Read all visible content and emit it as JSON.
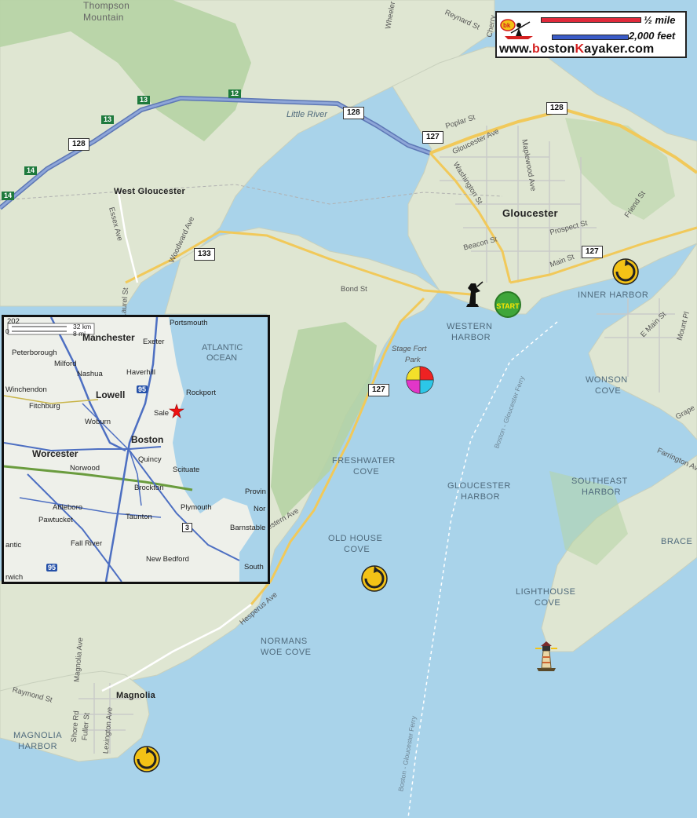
{
  "legend": {
    "scale_mile": "½ mile",
    "scale_feet": "2,000 feet",
    "site_prefix": "www.",
    "site_b": "b",
    "site_mid": "oston",
    "site_k": "K",
    "site_end": "ayaker.com",
    "logo_text": "bk",
    "bar_mile_color": "#e02a3b",
    "bar_feet_color": "#3a5bc7"
  },
  "labels": {
    "thompson": "Thompson",
    "mountain": "Mountain",
    "west_gloucester": "West Gloucester",
    "gloucester": "Gloucester",
    "little_river": "Little River",
    "magnolia": "Magnolia",
    "inner_harbor_1": "INNER HARBOR",
    "western_harbor_1": "WESTERN",
    "western_harbor_2": "HARBOR",
    "wonson_1": "WONSON",
    "wonson_2": "COVE",
    "freshwater_1": "FRESHWATER",
    "freshwater_2": "COVE",
    "gloucester_harbor_1": "GLOUCESTER",
    "gloucester_harbor_2": "HARBOR",
    "southeast_1": "SOUTHEAST",
    "southeast_2": "HARBOR",
    "brace": "BRACE",
    "old_house_1": "OLD HOUSE",
    "old_house_2": "COVE",
    "lighthouse_1": "LIGHTHOUSE",
    "lighthouse_2": "COVE",
    "normans_1": "NORMANS",
    "normans_2": "WOE COVE",
    "magnolia_harbor_1": "MAGNOLIA",
    "magnolia_harbor_2": "HARBOR",
    "stage_fort_1": "Stage Fort",
    "stage_fort_2": "Park",
    "start": "START"
  },
  "streets": {
    "reynard": "Reynard St",
    "wheeler": "Wheeler",
    "poplar": "Poplar St",
    "gloucester_ave": "Gloucester Ave",
    "maplewood": "Maplewood Ave",
    "washington": "Washington St",
    "beacon": "Beacon St",
    "prospect": "Prospect St",
    "main": "Main St",
    "friend": "Friend St",
    "essex": "Essex Ave",
    "woodward": "Woodward Ave",
    "laurel": "Laurel St",
    "bond": "Bond St",
    "western_ave": "Western Ave",
    "hesperus": "Hesperus Ave",
    "magnolia_ave": "Magnolia Ave",
    "raymond": "Raymond St",
    "shore": "Shore Rd",
    "fuller": "Fuller St",
    "lexington": "Lexington Ave",
    "e_main": "E Main St",
    "farrington": "Farrington Av",
    "mount": "Mount Pl",
    "grape": "Grape",
    "ferry1": "Boston - Gloucester Ferry",
    "ferry2": "Boston - Gloucester Ferry",
    "cherry": "Cherry"
  },
  "signs": {
    "r128_a": "128",
    "r128_b": "128",
    "r128_c": "128",
    "r127_a": "127",
    "r127_b": "127",
    "r127_c": "127",
    "r133": "133",
    "exit12": "12",
    "exit13_a": "13",
    "exit13_b": "13",
    "exit14_a": "14",
    "exit14_b": "14"
  },
  "inset": {
    "portsmouth": "Portsmouth",
    "manchester": "Manchester",
    "exeter": "Exeter",
    "atlantic": "ATLANTIC",
    "ocean": "OCEAN",
    "peterborough": "Peterborough",
    "milford": "Milford",
    "nashua": "Nashua",
    "haverhill": "Haverhill",
    "rockport": "Rockport",
    "fitchburg": "Fitchburg",
    "lowell": "Lowell",
    "salem": "Sale",
    "winchendon": "Winchendon",
    "woburn": "Woburn",
    "boston": "Boston",
    "worcester": "Worcester",
    "quincy": "Quincy",
    "norwood": "Norwood",
    "scituate": "Scituate",
    "brockton": "Brockton",
    "attleboro": "Attleboro",
    "plymouth": "Plymouth",
    "pawtucket": "Pawtucket",
    "taunton": "Taunton",
    "fall_river": "Fall River",
    "new_bedford": "New Bedford",
    "barnstable": "Barnstable",
    "provin": "Provin",
    "nor": "Nor",
    "south": "South",
    "antic": "antic",
    "rwich": "rwich",
    "scale_km": "32 km",
    "scale_mi": "8 mi",
    "scale_202": "202",
    "scale_0": "0",
    "i95_a": "95",
    "i95_b": "95",
    "r3": "3"
  }
}
